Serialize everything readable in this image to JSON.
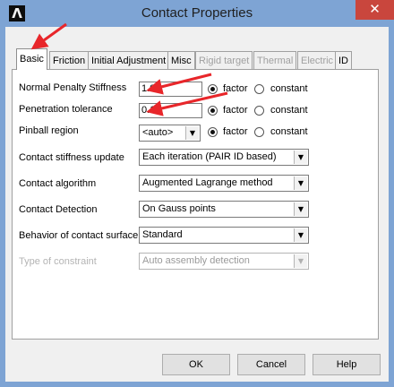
{
  "window": {
    "title": "Contact Properties",
    "icon": "ansys-logo-icon",
    "close_glyph": "✕"
  },
  "tabs": [
    {
      "label": "Basic",
      "state": "active"
    },
    {
      "label": "Friction",
      "state": "enabled"
    },
    {
      "label": "Initial Adjustment",
      "state": "enabled"
    },
    {
      "label": "Misc",
      "state": "enabled"
    },
    {
      "label": "Rigid target",
      "state": "disabled"
    },
    {
      "label": "Thermal",
      "state": "disabled"
    },
    {
      "label": "Electric",
      "state": "disabled"
    },
    {
      "label": "ID",
      "state": "enabled"
    }
  ],
  "fields": {
    "normal_penalty": {
      "label": "Normal Penalty Stiffness",
      "value": "1.0",
      "options": [
        "factor",
        "constant"
      ],
      "selected": "factor"
    },
    "penetration_tolerance": {
      "label": "Penetration tolerance",
      "value": "0.1",
      "options": [
        "factor",
        "constant"
      ],
      "selected": "factor"
    },
    "pinball_region": {
      "label": "Pinball region",
      "value": "<auto>",
      "options": [
        "factor",
        "constant"
      ],
      "selected": "factor"
    },
    "contact_stiffness_update": {
      "label": "Contact stiffness update",
      "value": "Each iteration (PAIR ID based)"
    },
    "contact_algorithm": {
      "label": "Contact algorithm",
      "value": "Augmented Lagrange method"
    },
    "contact_detection": {
      "label": "Contact Detection",
      "value": "On Gauss points"
    },
    "behavior_contact_surface": {
      "label": "Behavior of contact surface",
      "value": "Standard"
    },
    "type_of_constraint": {
      "label": "Type of constraint",
      "value": "Auto assembly detection",
      "disabled": true
    }
  },
  "buttons": {
    "ok": "OK",
    "cancel": "Cancel",
    "help": "Help"
  },
  "dropdown_glyph": "▼",
  "colors": {
    "titlebar": "#7ea4d4",
    "close": "#c9463d",
    "annotation_arrow": "#e8262a"
  }
}
